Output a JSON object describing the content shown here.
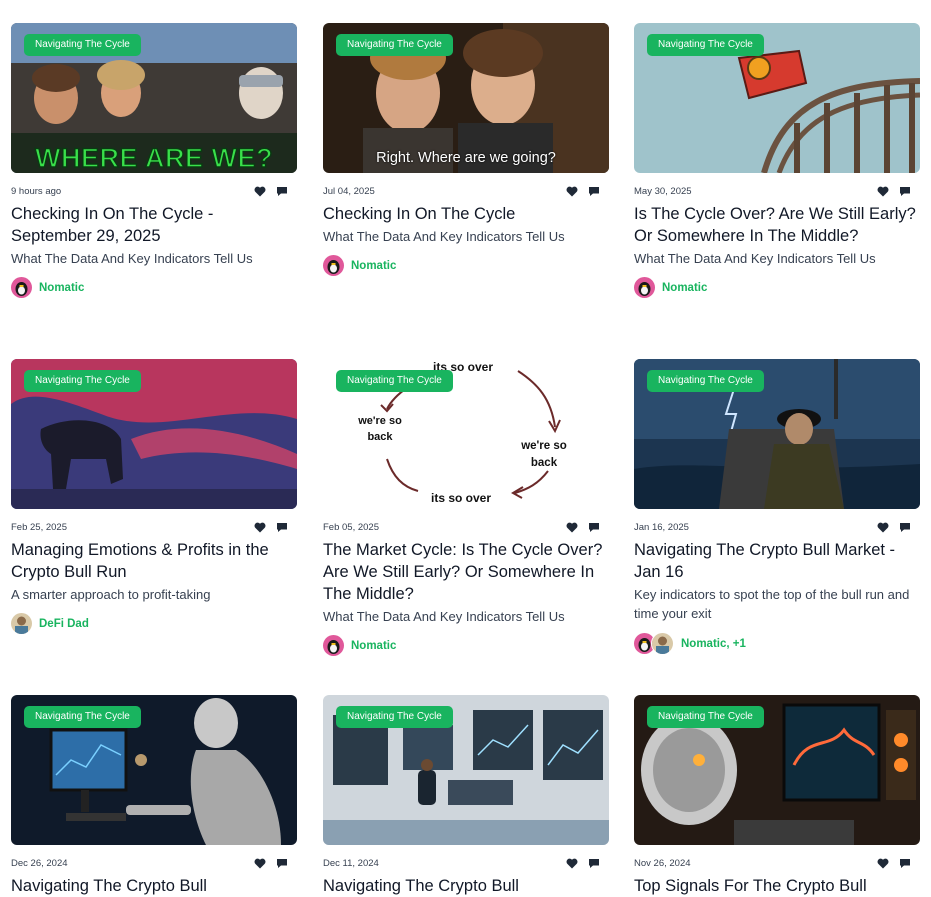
{
  "tag_label": "Navigating The Cycle",
  "colors": {
    "accent": "#19b45f",
    "text": "#111827",
    "muted": "#374151"
  },
  "cards": [
    {
      "date": "9 hours ago",
      "title": "Checking In On The Cycle - September 29, 2025",
      "subtitle": "What The Data And Key Indicators Tell Us",
      "author": "Nomatic",
      "image_text": "WHERE ARE WE?"
    },
    {
      "date": "Jul 04, 2025",
      "title": "Checking In On The Cycle",
      "subtitle": "What The Data And Key Indicators Tell Us",
      "author": "Nomatic",
      "image_text": "Right. Where are we going?"
    },
    {
      "date": "May 30, 2025",
      "title": "Is The Cycle Over? Are We Still Early? Or Somewhere In The Middle?",
      "subtitle": "What The Data And Key Indicators Tell Us",
      "author": "Nomatic"
    },
    {
      "date": "Feb 25, 2025",
      "title": "Managing Emotions & Profits in the Crypto Bull Run",
      "subtitle": "A smarter approach to profit-taking",
      "author": "DeFi Dad"
    },
    {
      "date": "Feb 05, 2025",
      "title": "The Market Cycle: Is The Cycle Over? Are We Still Early? Or Somewhere In The Middle?",
      "subtitle": "What The Data And Key Indicators Tell Us",
      "author": "Nomatic",
      "image_labels": [
        "its so over",
        "we're so back",
        "we're so back",
        "its so over"
      ]
    },
    {
      "date": "Jan 16, 2025",
      "title": "Navigating The Crypto Bull Market - Jan 16",
      "subtitle": "Key indicators to spot the top of the bull run and time your exit",
      "author": "Nomatic, +1"
    },
    {
      "date": "Dec 26, 2024",
      "title": "Navigating The Crypto Bull"
    },
    {
      "date": "Dec 11, 2024",
      "title": "Navigating The Crypto Bull"
    },
    {
      "date": "Nov 26, 2024",
      "title": "Top Signals For The Crypto Bull"
    }
  ]
}
